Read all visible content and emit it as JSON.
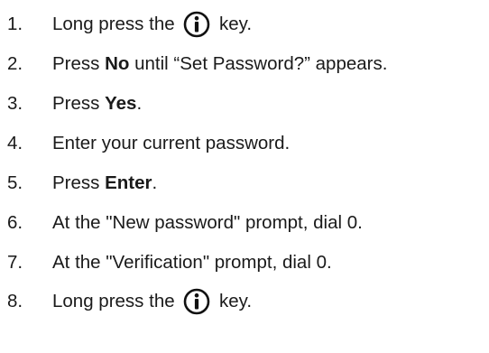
{
  "steps": [
    {
      "number": "1.",
      "segments": [
        {
          "type": "text",
          "value": "Long press the "
        },
        {
          "type": "icon",
          "icon": "info-key-icon"
        },
        {
          "type": "text",
          "value": " key."
        }
      ]
    },
    {
      "number": "2.",
      "segments": [
        {
          "type": "text",
          "value": "Press "
        },
        {
          "type": "bold",
          "value": "No"
        },
        {
          "type": "text",
          "value": " until “Set Password?” appears."
        }
      ]
    },
    {
      "number": "3.",
      "segments": [
        {
          "type": "text",
          "value": "Press "
        },
        {
          "type": "bold",
          "value": "Yes"
        },
        {
          "type": "text",
          "value": "."
        }
      ]
    },
    {
      "number": "4.",
      "segments": [
        {
          "type": "text",
          "value": "Enter your current password."
        }
      ]
    },
    {
      "number": "5.",
      "segments": [
        {
          "type": "text",
          "value": "Press "
        },
        {
          "type": "bold",
          "value": "Enter"
        },
        {
          "type": "text",
          "value": "."
        }
      ]
    },
    {
      "number": "6.",
      "segments": [
        {
          "type": "text",
          "value": "At the \"New password\" prompt, dial 0."
        }
      ]
    },
    {
      "number": "7.",
      "segments": [
        {
          "type": "text",
          "value": "At the \"Verification\" prompt, dial 0."
        }
      ]
    },
    {
      "number": "8.",
      "segments": [
        {
          "type": "text",
          "value": "Long press the "
        },
        {
          "type": "icon",
          "icon": "info-key-icon"
        },
        {
          "type": "text",
          "value": " key."
        }
      ]
    }
  ]
}
